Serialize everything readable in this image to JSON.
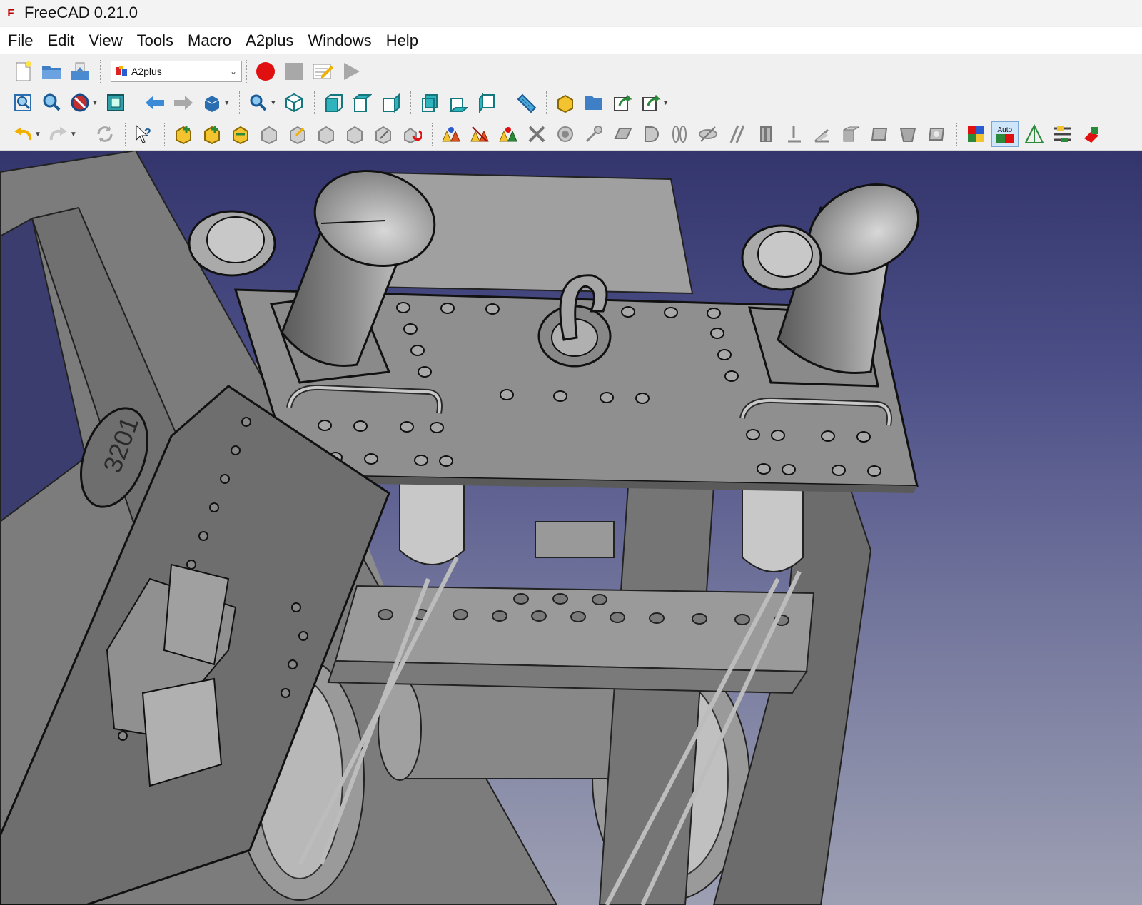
{
  "window": {
    "title": "FreeCAD 0.21.0",
    "logo_text": "F"
  },
  "menu": [
    "File",
    "Edit",
    "View",
    "Tools",
    "Macro",
    "A2plus",
    "Windows",
    "Help"
  ],
  "workbench": {
    "selected": "A2plus"
  },
  "toolbar": {
    "auto_label": "Auto"
  },
  "model": {
    "plate_number": "3201"
  },
  "colors": {
    "viewport_top": "#33356c",
    "viewport_bottom": "#9da0b3",
    "record_red": "#e01010",
    "part_gray": "#8a8a8a"
  }
}
